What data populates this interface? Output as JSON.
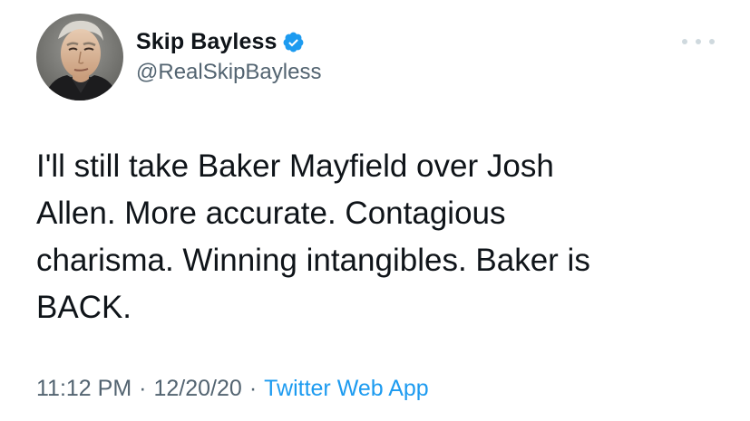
{
  "user": {
    "display_name": "Skip Bayless",
    "handle": "@RealSkipBayless",
    "verified": true,
    "avatar": "profile-photo"
  },
  "tweet": {
    "text": "I'll still take Baker Mayfield over Josh\nAllen. More accurate. Contagious\ncharisma. Winning intangibles. Baker is\nBACK.",
    "time": "11:12 PM",
    "date": "12/20/20",
    "separator": "·",
    "source": "Twitter Web App"
  },
  "icons": {
    "verified": "verified-badge-icon",
    "more": "more-options-icon"
  },
  "colors": {
    "text": "#0f1419",
    "secondary": "#536471",
    "link": "#1d9bf0",
    "verified": "#1d9bf0"
  }
}
